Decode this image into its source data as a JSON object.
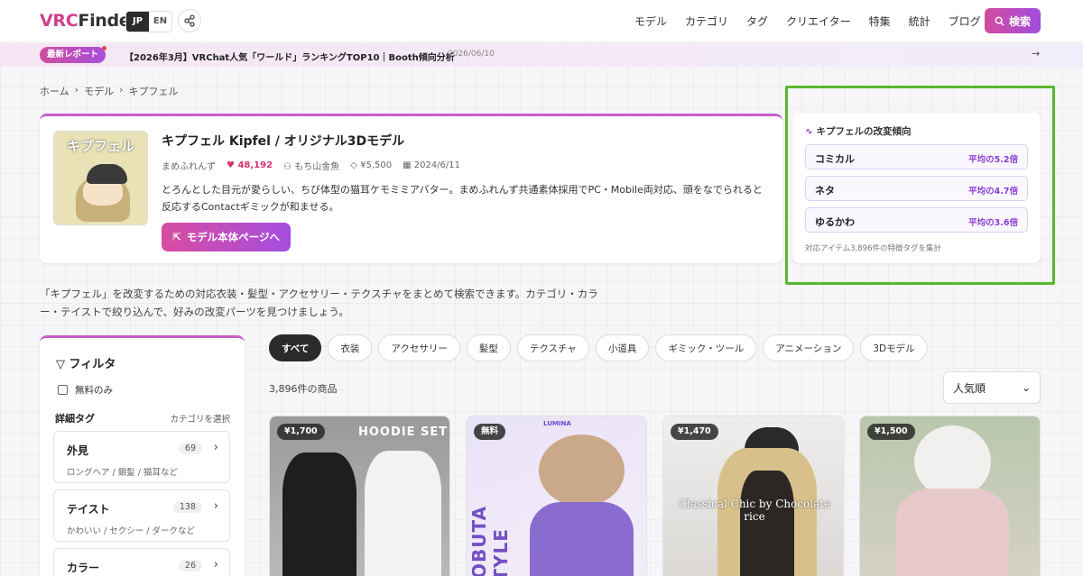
{
  "header": {
    "logo_a": "VRC",
    "logo_b": "Finder",
    "lang": [
      "JP",
      "EN"
    ],
    "nav": [
      "モデル",
      "カテゴリ",
      "タグ",
      "クリエイター",
      "特集",
      "統計",
      "ブログ"
    ],
    "search_label": "検索"
  },
  "banner": {
    "badge": "最新レポート",
    "text": "【2026年3月】VRChat人気「ワールド」ランキングTOP10｜Booth傾向分析",
    "date": "2026/06/10"
  },
  "breadcrumb": [
    "ホーム",
    "モデル",
    "キプフェル"
  ],
  "product": {
    "thumb_title": "キプフェル",
    "title": "キプフェル Kipfel / オリジナル3Dモデル",
    "creator": "まめふれんず",
    "likes": "48,192",
    "author": "もち山金魚",
    "price": "¥5,500",
    "date": "2024/6/11",
    "description": "とろんとした目元が愛らしい、ちび体型の猫耳ケモミミアバター。まめふれんず共通素体採用でPC・Mobile両対応、頭をなでられると反応するContactギミックが和ませる。",
    "cta": "モデル本体ページへ"
  },
  "trend": {
    "title": "キプフェルの改変傾向",
    "items": [
      {
        "name": "コミカル",
        "value": "平均の5.2倍"
      },
      {
        "name": "ネタ",
        "value": "平均の4.7倍"
      },
      {
        "name": "ゆるかわ",
        "value": "平均の3.6倍"
      }
    ],
    "footer": "対応アイテム3,896件の特徴タグを集計"
  },
  "intro": "「キプフェル」を改変するための対応衣装・髪型・アクセサリー・テクスチャをまとめて検索できます。カテゴリ・カラー・テイストで絞り込んで、好みの改変パーツを見つけましょう。",
  "filter": {
    "title": "フィルタ",
    "free_only": "無料のみ",
    "tags_label": "詳細タグ",
    "category_select": "カテゴリを選択",
    "groups": [
      {
        "name": "外見",
        "count": "69",
        "sub": "ロングヘア / 銀髪 / 猫耳など"
      },
      {
        "name": "テイスト",
        "count": "138",
        "sub": "かわいい / セクシー / ダークなど"
      },
      {
        "name": "カラー",
        "count": "26",
        "sub": ""
      }
    ]
  },
  "tabs": [
    "すべて",
    "衣装",
    "アクセサリー",
    "髪型",
    "テクスチャ",
    "小道具",
    "ギミック・ツール",
    "アニメーション",
    "3Dモデル"
  ],
  "count_text": "3,896件の商品",
  "sort": "人気順",
  "products": [
    {
      "price": "¥1,700",
      "caption": "HOODIE SET"
    },
    {
      "price": "無料",
      "caption": "LUMINA",
      "side": "OOBUTA STYLE"
    },
    {
      "price": "¥1,470",
      "caption": "Classical Chic by Chocolate rice"
    },
    {
      "price": "¥1,500",
      "caption": ""
    }
  ]
}
